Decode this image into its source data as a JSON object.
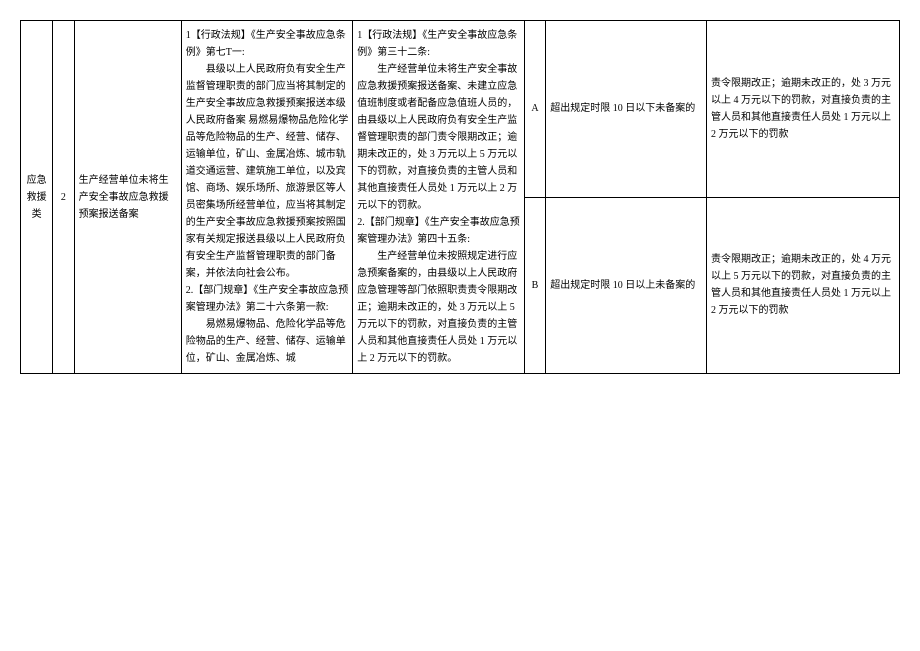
{
  "category": "应急救援类",
  "row_num": "2",
  "violation": "生产经营单位未将生产安全事故应急救援预案报送备案",
  "basis1_p1": "1【行政法规】《生产安全事故应急条例》第七T一:",
  "basis1_p2": "县级以上人民政府负有安全生产监督管理职责的部门应当将其制定的生产安全事故应急救援预案报送本级人民政府备案 易燃易爆物品危险化学品等危险物品的生产、经营、储存、运输单位，矿山、金属冶炼、城市轨道交通运营、建筑施工单位，以及宾馆、商场、娱乐场所、旅游景区等人员密集场所经营单位，应当将其制定的生产安全事故应急救援预案按照国家有关规定报送县级以上人民政府负有安全生产监督管理职责的部门备案，并依法向社会公布。",
  "basis1_p3": "2.【部门规章】《生产安全事故应急预案管理办法》第二十六条第一款:",
  "basis1_p4": "易燃易爆物品、危险化学品等危险物品的生产、经营、储存、运输单位，矿山、金属冶炼、城",
  "basis2_p1": "1【行政法规】《生产安全事故应急条例》第三十二条:",
  "basis2_p2": "生产经营单位未将生产安全事故应急救援预案报送备案、未建立应急值班制度或者配备应急值班人员的，由县级以上人民政府负有安全生产监督管理职责的部门责令限期改正；逾期未改正的，处 3 万元以上 5 万元以下的罚款，对直接负责的主管人员和其他直接责任人员处 1 万元以上 2 万元以下的罚款。",
  "basis2_p3": "2.【部门规章】《生产安全事故应急预案管理办法》第四十五条:",
  "basis2_p4": "生产经营单位未按照规定进行应急预案备案的，由县级以上人民政府应急管理等部门依照职责责令限期改正；逾期未改正的，处 3 万元以上 5 万元以下的罚款，对直接负责的主管人员和其他直接责任人员处 1 万元以上 2 万元以下的罚款。",
  "level_a": "A",
  "circumstance_a": "超出规定时限 10 日以下未备案的",
  "penalty_a": "责令限期改正；逾期未改正的，处 3 万元以上 4 万元以下的罚款，对直接负责的主管人员和其他直接责任人员处 1 万元以上 2 万元以下的罚款",
  "level_b": "B",
  "circumstance_b": "超出规定时限 10 日以上未备案的",
  "penalty_b": "责令限期改正；逾期未改正的，处 4 万元以上 5 万元以下的罚款，对直接负责的主管人员和其他直接责任人员处 1 万元以上 2 万元以下的罚款"
}
